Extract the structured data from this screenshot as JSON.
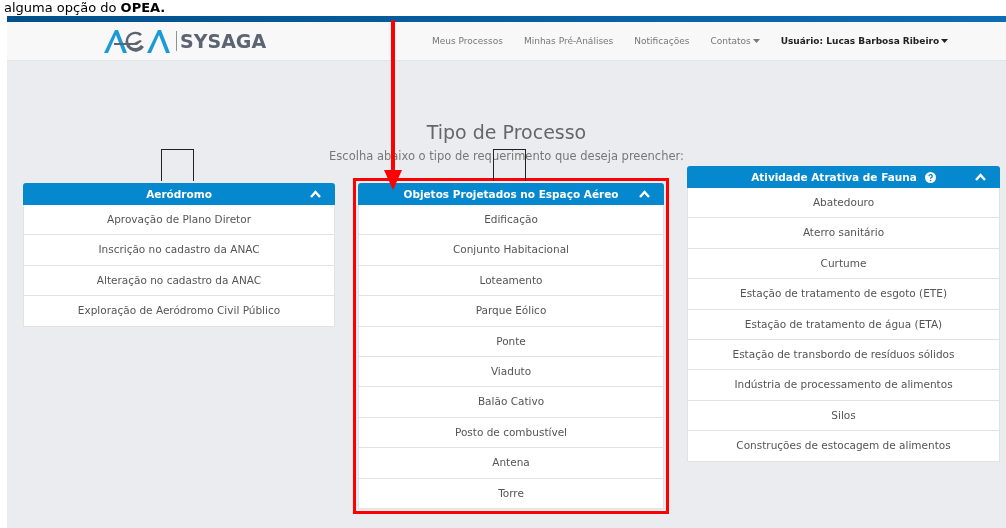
{
  "caption": "alguma opção do **OPEA.**",
  "navbar": {
    "brand": "SYSAGA",
    "links": [
      {
        "label": "Meus Processos",
        "dropdown": false
      },
      {
        "label": "Minhas Pré-Análises",
        "dropdown": false
      },
      {
        "label": "Notificações",
        "dropdown": false
      },
      {
        "label": "Contatos",
        "dropdown": true
      }
    ],
    "user": "Usuário: Lucas Barbosa Ribeiro"
  },
  "title": "Tipo de Processo",
  "subtitle": "Escolha abaixo o tipo de requerimento que deseja preencher:",
  "panels": [
    {
      "title": "Aeródromo",
      "help": false,
      "expanded": true,
      "highlighted": false,
      "bracket": true,
      "items": [
        "Aprovação de Plano Diretor",
        "Inscrição no cadastro da ANAC",
        "Alteração no cadastro da ANAC",
        "Exploração de Aeródromo Civil Público"
      ]
    },
    {
      "title": "Objetos Projetados no Espaço Aéreo",
      "help": false,
      "expanded": true,
      "highlighted": true,
      "bracket": true,
      "items": [
        "Edificação",
        "Conjunto Habitacional",
        "Loteamento",
        "Parque Eólico",
        "Ponte",
        "Viaduto",
        "Balão Cativo",
        "Posto de combustível",
        "Antena",
        "Torre"
      ]
    },
    {
      "title": "Atividade Atrativa de Fauna",
      "help": true,
      "expanded": true,
      "highlighted": false,
      "bracket": false,
      "items": [
        "Abatedouro",
        "Aterro sanitário",
        "Curtume",
        "Estação de tratamento de esgoto (ETE)",
        "Estação de tratamento de água (ETA)",
        "Estação de transbordo de resíduos sólidos",
        "Indústria de processamento de alimentos",
        "Silos",
        "Construções de estocagem de alimentos"
      ]
    }
  ]
}
